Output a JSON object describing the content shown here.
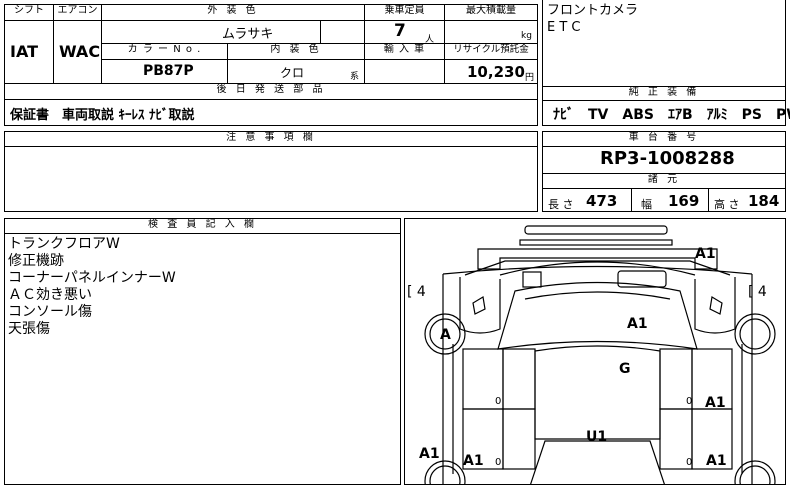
{
  "top_table": {
    "shift_label": "シフト",
    "aircon_label": "エアコン",
    "shift_value": "IAT",
    "aircon_value": "WAC",
    "exterior_color_label": "外 装 色",
    "exterior_color_value": "ムラサキ",
    "capacity_label": "乗車定員",
    "capacity_value": "7",
    "capacity_unit": "人",
    "max_load_label": "最大積載量",
    "max_load_unit": "kg",
    "color_no_label": "カ ラ ー N o .",
    "color_no_value": "PB87P",
    "interior_color_label": "内 装 色",
    "interior_color_value": "クロ",
    "interior_color_suffix": "系",
    "import_label": "輸 入 車",
    "recycle_label": "リサイクル預託金",
    "recycle_value": "10,230",
    "recycle_unit": "円",
    "extras_label": "後 日 発 送 部 品",
    "extras_value": "保証書　車両取説 ｷｰﾚｽ ﾅﾋﾞ取説"
  },
  "features": {
    "items": [
      "フロントカメラ",
      "E T C"
    ],
    "genuine_label": "純 正 装 備",
    "genuine_value": "ﾅﾋﾞ　TV　ABS　ｴｱB　ｱﾙﾐ　PS　PW"
  },
  "notes": {
    "label": "注 意 事 項 欄"
  },
  "chassis": {
    "label": "車 台 番 号",
    "value": "RP3-1008288",
    "specs_label": "諸 元",
    "length_label": "長 さ",
    "length_value": "473",
    "width_label": "幅",
    "width_value": "169",
    "height_label": "高 さ",
    "height_value": "184"
  },
  "inspector": {
    "label": "検 査 員 記 入 欄",
    "lines": [
      "トランクフロアW",
      "修正機跡",
      "コーナーパネルインナーW",
      "ＡＣ効き悪い",
      "コンソール傷",
      "天張傷"
    ]
  },
  "diagram": {
    "left_bracket": "[ 4",
    "right_bracket": "[ 4",
    "marks": [
      "A1",
      "A",
      "A1",
      "G",
      "A1",
      "U1",
      "A1",
      "A1",
      "A1"
    ],
    "zeros": [
      "0",
      "0",
      "0",
      "0"
    ]
  }
}
